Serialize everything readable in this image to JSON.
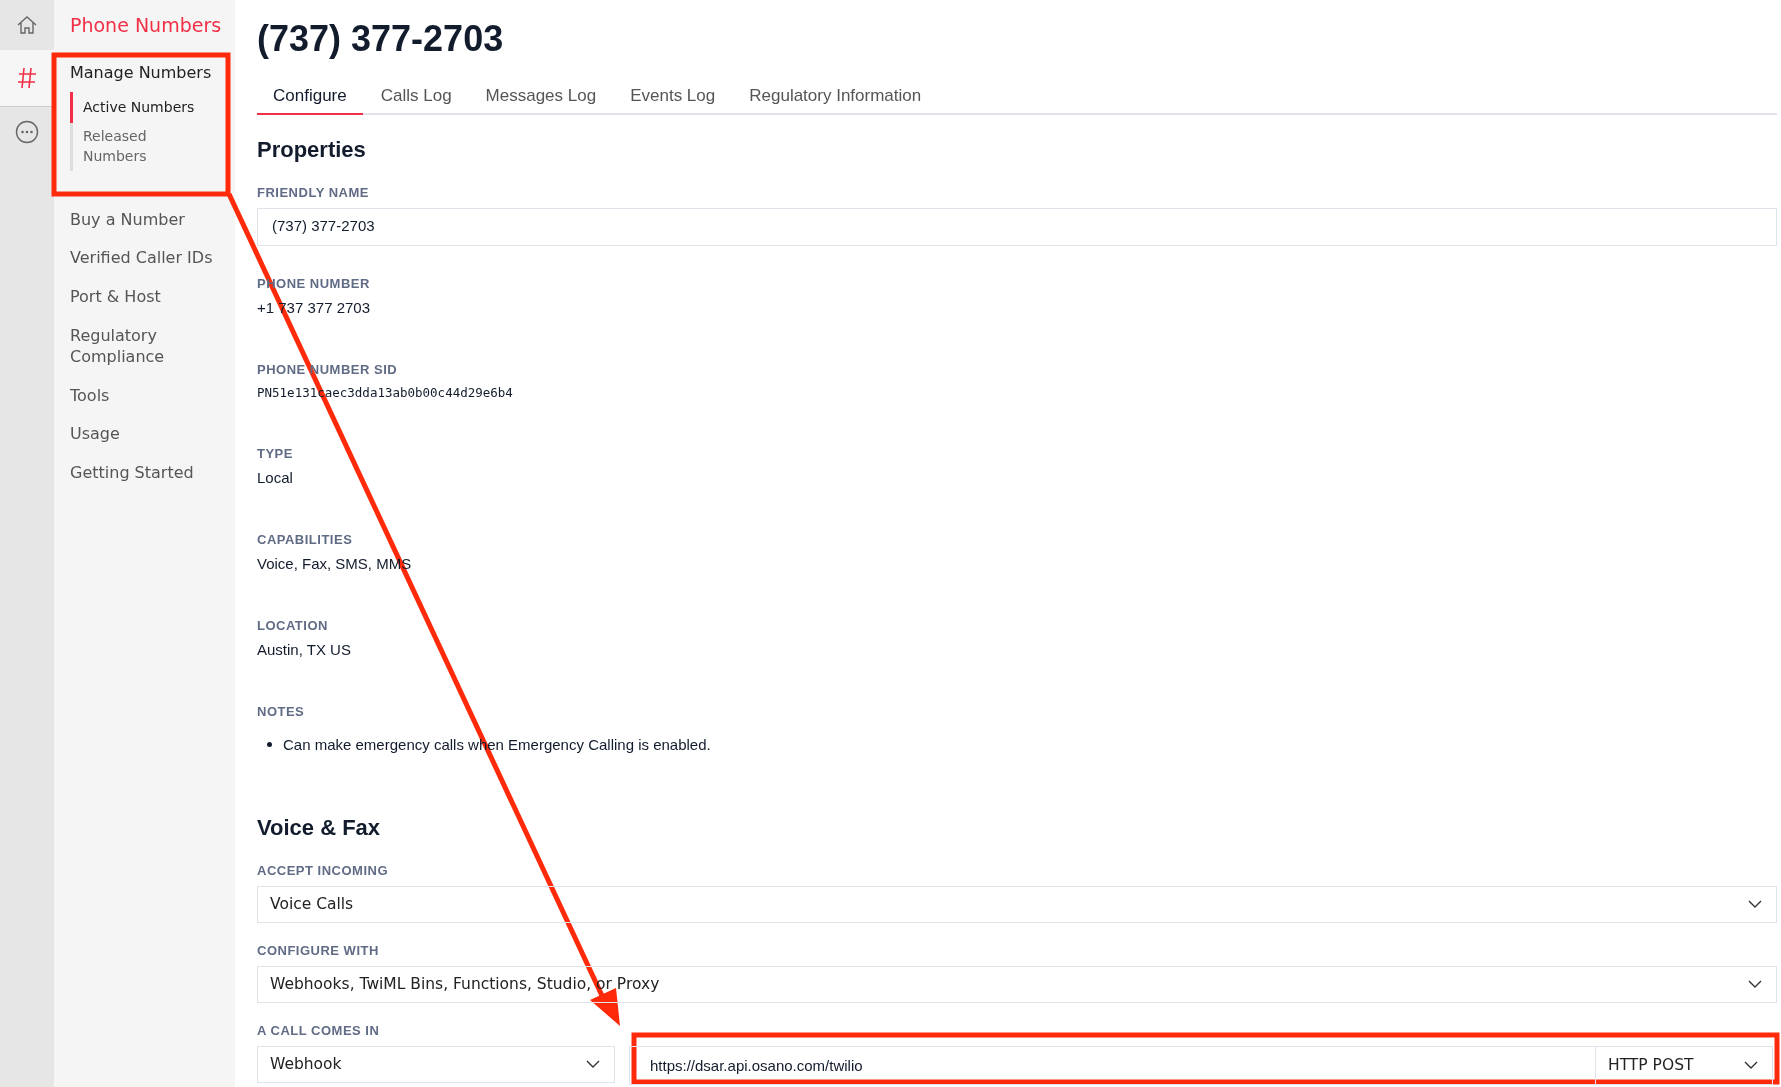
{
  "rail": [
    {
      "kind": "home",
      "selected": false
    },
    {
      "kind": "hash",
      "selected": true
    },
    {
      "kind": "more",
      "selected": false
    }
  ],
  "sidebar": {
    "title": "Phone Numbers",
    "items": [
      {
        "label": "Manage Numbers",
        "children": [
          {
            "label": "Active Numbers",
            "selected": true
          },
          {
            "label": "Released Numbers",
            "selected": false
          }
        ]
      },
      {
        "label": "Buy a Number"
      },
      {
        "label": "Verified Caller IDs"
      },
      {
        "label": "Port & Host"
      },
      {
        "label": "Regulatory Compliance"
      },
      {
        "label": "Tools"
      },
      {
        "label": "Usage"
      },
      {
        "label": "Getting Started"
      }
    ]
  },
  "page_title": "(737) 377-2703",
  "tabs": [
    {
      "label": "Configure",
      "selected": true
    },
    {
      "label": "Calls Log",
      "selected": false
    },
    {
      "label": "Messages Log",
      "selected": false
    },
    {
      "label": "Events Log",
      "selected": false
    },
    {
      "label": "Regulatory Information",
      "selected": false
    }
  ],
  "properties": {
    "heading": "Properties",
    "fields": [
      {
        "kind": "input",
        "label": "FRIENDLY NAME",
        "value": "(737) 377-2703"
      },
      {
        "kind": "text",
        "label": "PHONE NUMBER",
        "value": "+1 737 377 2703"
      },
      {
        "kind": "mono",
        "label": "PHONE NUMBER SID",
        "value": "PN51e131caec3dda13ab0b00c44d29e6b4"
      },
      {
        "kind": "text",
        "label": "TYPE",
        "value": "Local"
      },
      {
        "kind": "text",
        "label": "CAPABILITIES",
        "value": "Voice, Fax, SMS, MMS"
      },
      {
        "kind": "text",
        "label": "LOCATION",
        "value": "Austin, TX US"
      },
      {
        "kind": "list",
        "label": "NOTES",
        "items": [
          "Can make emergency calls when Emergency Calling is enabled."
        ]
      }
    ]
  },
  "voice_fax": {
    "heading": "Voice & Fax",
    "accept_incoming": {
      "label": "ACCEPT INCOMING",
      "value": "Voice Calls"
    },
    "configure_with": {
      "label": "CONFIGURE WITH",
      "value": "Webhooks, TwiML Bins, Functions, Studio, or Proxy"
    },
    "call_comes_in": {
      "label": "A CALL COMES IN",
      "handler": "Webhook",
      "url": "https://dsar.api.osano.com/twilio",
      "method": "HTTP POST"
    }
  }
}
